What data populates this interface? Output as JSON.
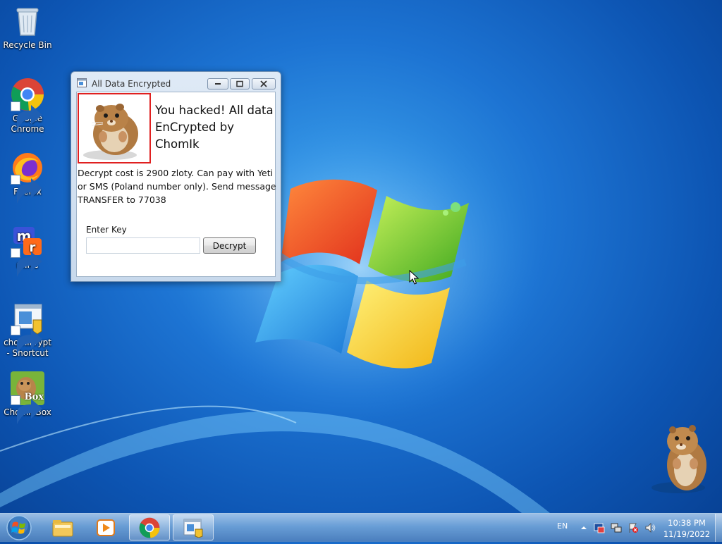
{
  "desktop": {
    "icons": [
      {
        "label": "Recycle Bin",
        "icon": "recycle-bin-icon"
      },
      {
        "label": "Google Chrome",
        "icon": "chrome-icon"
      },
      {
        "label": "Firefox",
        "icon": "firefox-icon"
      },
      {
        "label": "mIRC",
        "icon": "mirc-icon"
      },
      {
        "label": "chomikrypt - Shortcut",
        "icon": "app-window-icon"
      },
      {
        "label": "ChomikBox",
        "icon": "chomikbox-icon",
        "badge": "Box"
      }
    ]
  },
  "window": {
    "title": "All Data Encrypted",
    "headline": "You hacked! All data EnCrypted by ChomIk",
    "message": "Decrypt cost is 2900 zloty. Can pay with Yeti or SMS (Poland number only). Send message TRANSFER to 77038",
    "key_label": "Enter Key",
    "key_value": "",
    "decrypt_label": "Decrypt"
  },
  "taskbar": {
    "items": [
      {
        "icon": "file-explorer-icon",
        "active": false
      },
      {
        "icon": "media-player-icon",
        "active": false
      },
      {
        "icon": "chrome-icon",
        "active": true
      },
      {
        "icon": "app-window-icon",
        "active": true
      }
    ],
    "tray": {
      "language": "EN",
      "time": "10:38 PM",
      "date": "11/19/2022"
    }
  },
  "colors": {
    "desktop_blue": "#1d74d3",
    "frame_red": "#e02020"
  }
}
